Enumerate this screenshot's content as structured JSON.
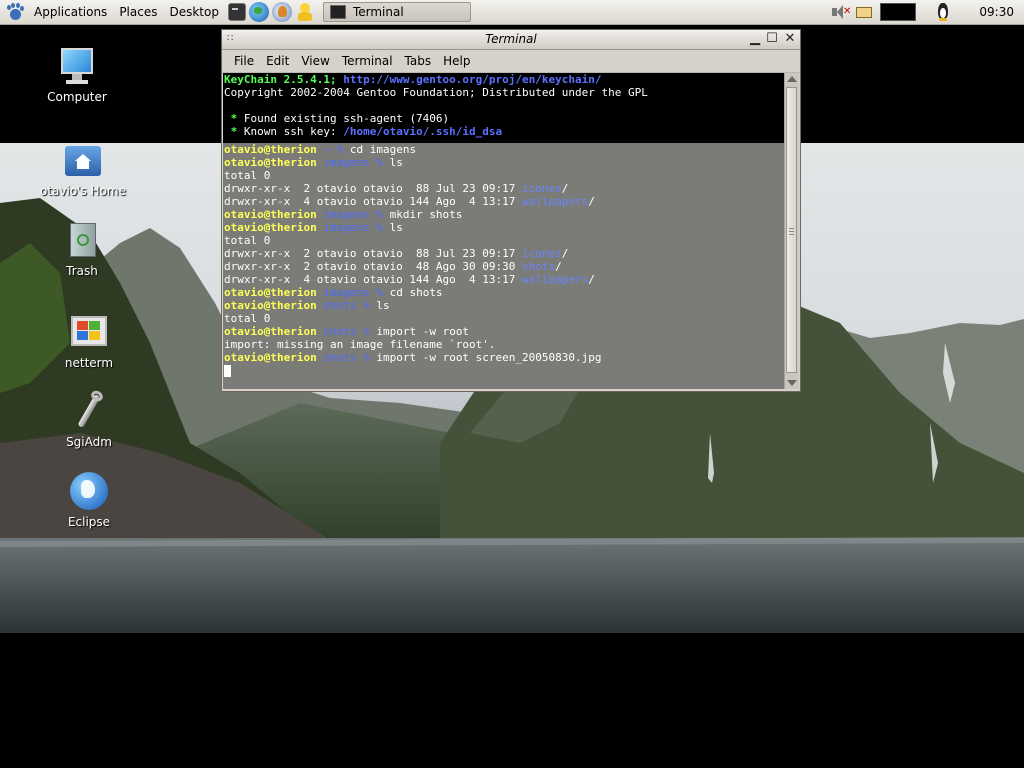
{
  "top_panel": {
    "menus": [
      "Applications",
      "Places",
      "Desktop"
    ],
    "task_button_label": "Terminal",
    "clock": "09:30"
  },
  "desktop_icons": [
    {
      "label": "Computer"
    },
    {
      "label": "otavio's Home"
    },
    {
      "label": "Trash"
    },
    {
      "label": "netterm"
    },
    {
      "label": "SgiAdm"
    },
    {
      "label": "Eclipse"
    }
  ],
  "terminal": {
    "title": "Terminal",
    "menus": [
      "File",
      "Edit",
      "View",
      "Terminal",
      "Tabs",
      "Help"
    ],
    "header": {
      "keychain_name": "KeyChain 2.5.4.1;",
      "keychain_url": "http://www.gentoo.org/proj/en/keychain/",
      "copyright": "Copyright 2002-2004 Gentoo Foundation; Distributed under the GPL",
      "found_agent": "Found existing ssh-agent (7406)",
      "known_key_prefix": "Known ssh key: ",
      "known_key_path": "/home/otavio/.ssh/id_dsa"
    },
    "prompt_user": "otavio@therion",
    "session": [
      {
        "dir": "~",
        "cmd": "cd imagens"
      },
      {
        "dir": "imagens",
        "cmd": "ls"
      },
      {
        "out": "total 0"
      },
      {
        "perm": "drwxr-xr-x  2 otavio otavio  88 Jul 23 09:17 ",
        "name": "icones",
        "slash": "/"
      },
      {
        "perm": "drwxr-xr-x  4 otavio otavio 144 Ago  4 13:17 ",
        "name": "wallpapers",
        "slash": "/"
      },
      {
        "dir": "imagens",
        "cmd": "mkdir shots"
      },
      {
        "dir": "imagens",
        "cmd": "ls"
      },
      {
        "out": "total 0"
      },
      {
        "perm": "drwxr-xr-x  2 otavio otavio  88 Jul 23 09:17 ",
        "name": "icones",
        "slash": "/"
      },
      {
        "perm": "drwxr-xr-x  2 otavio otavio  48 Ago 30 09:30 ",
        "name": "shots",
        "slash": "/"
      },
      {
        "perm": "drwxr-xr-x  4 otavio otavio 144 Ago  4 13:17 ",
        "name": "wallpapers",
        "slash": "/"
      },
      {
        "dir": "imagens",
        "cmd": "cd shots"
      },
      {
        "dir": "shots",
        "cmd": "ls"
      },
      {
        "out": "total 0"
      },
      {
        "dir": "shots",
        "cmd": "import -w root"
      },
      {
        "out": "import: missing an image filename `root'."
      },
      {
        "dir": "shots",
        "cmd": "import -w root screen_20050830.jpg"
      }
    ]
  },
  "colors": {
    "prompt_user": "#ffff55",
    "prompt_dir": "#5b70ff",
    "keychain": "#55ff55",
    "link": "#5b70ff"
  }
}
